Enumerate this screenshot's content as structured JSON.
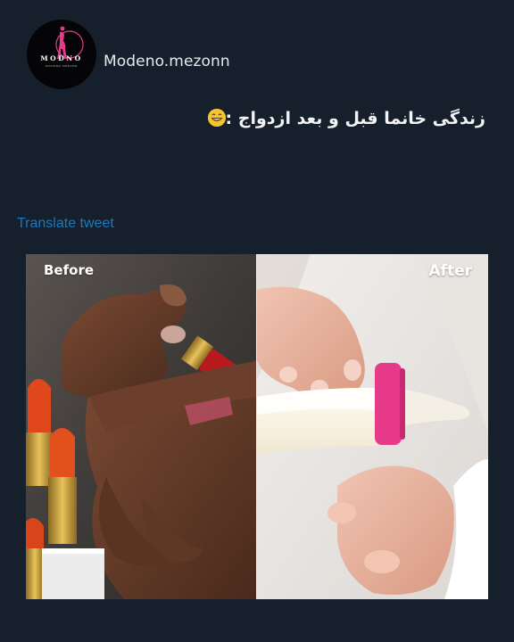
{
  "tweet": {
    "author": {
      "username": "Modeno.mezonn",
      "avatar": {
        "brand": "MODNO",
        "tagline": "MODENO MEZONN"
      }
    },
    "text": "زندگی خانما قبل و بعد ازدواج :",
    "emoji": "grinning-face-emoji",
    "translate_label": "Translate tweet",
    "media": {
      "before_label": "Before",
      "after_label": "After"
    }
  },
  "colors": {
    "background": "#16202c",
    "link": "#1d78bd",
    "text": "#e7e9ea",
    "bottle_cap": "#e83a8a",
    "lipstick": "#c8302a"
  }
}
